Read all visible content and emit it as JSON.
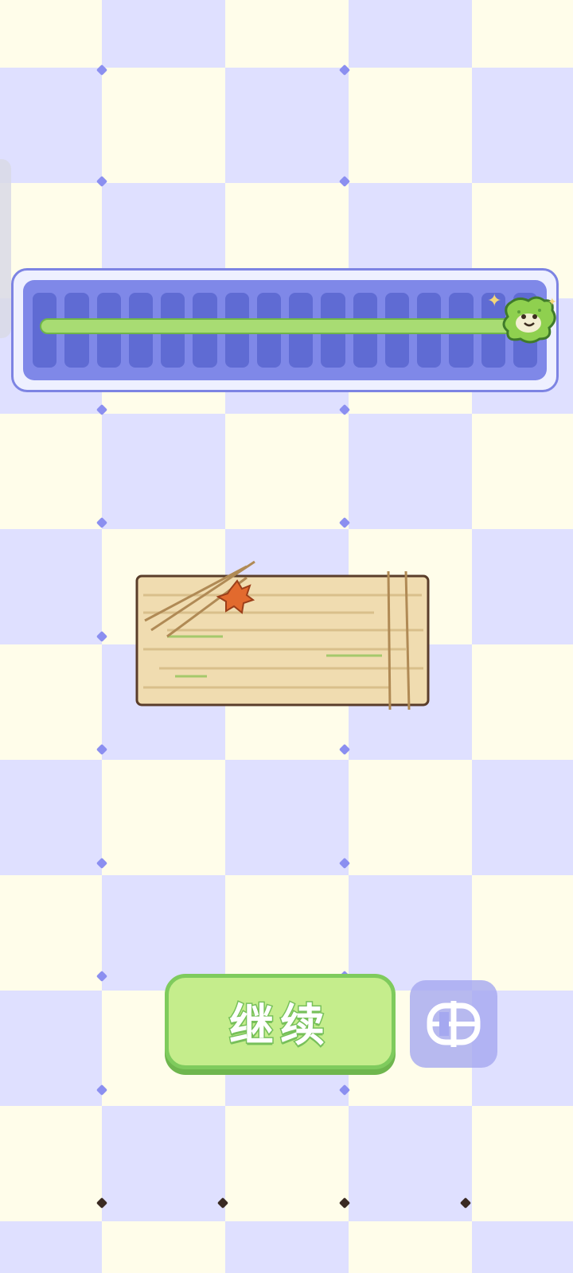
{
  "game": {
    "progress": {
      "value": 1.0
    },
    "continue_button": {
      "label": "继续"
    },
    "icon_button": {
      "icon": "film-reel-icon"
    },
    "colors": {
      "checker_light": "#fffdea",
      "checker_dark": "#dfe0ff",
      "progress_frame": "#7d84e3",
      "progress_fill": "#a8dc73",
      "button_green": "#c5ed8c"
    }
  }
}
